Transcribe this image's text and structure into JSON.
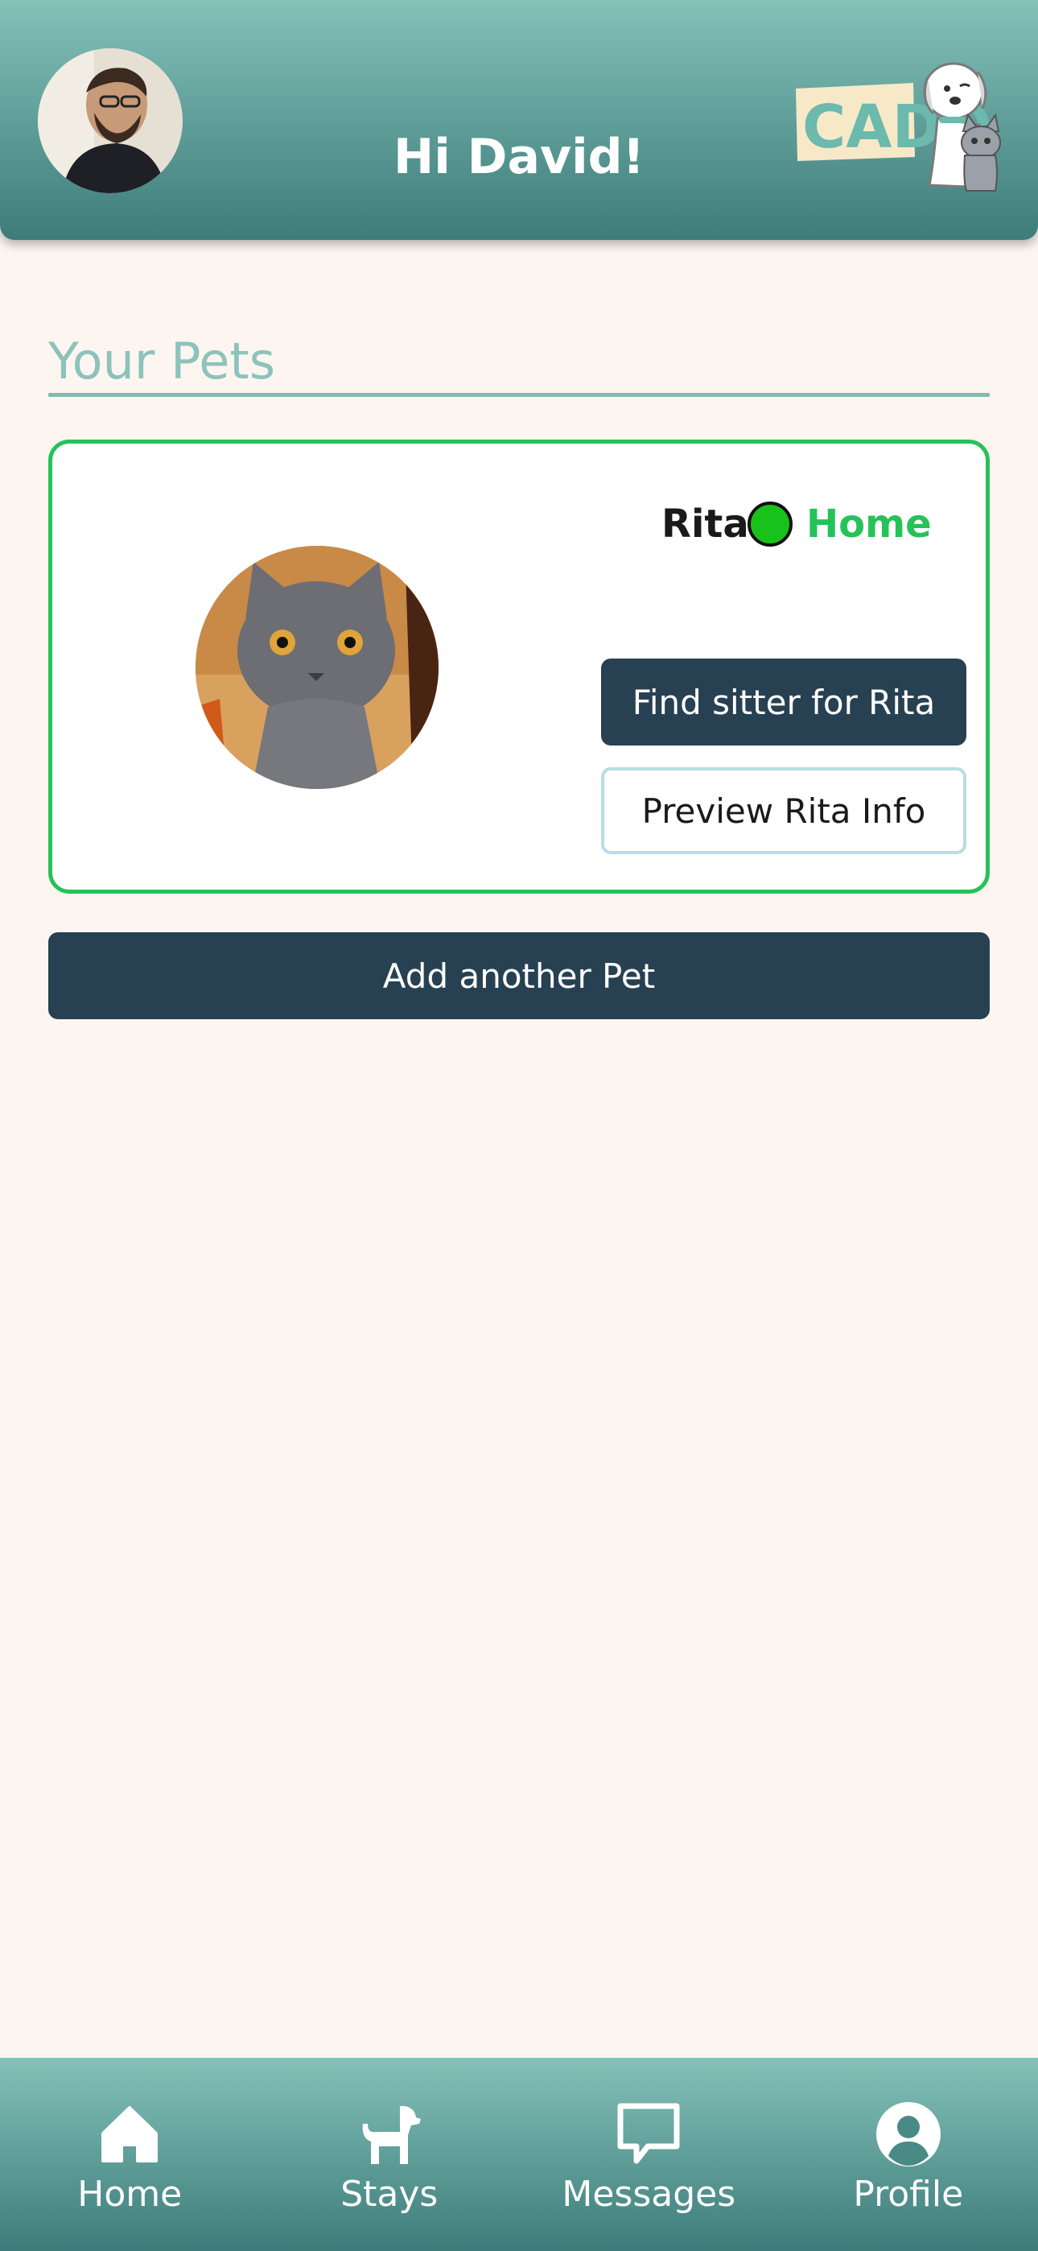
{
  "header": {
    "greeting": "Hi David!",
    "logo_text": "CADO"
  },
  "pets_section": {
    "title": "Your Pets"
  },
  "pets": [
    {
      "name": "Rita",
      "status": "Home",
      "status_color": "#27c15a",
      "find_sitter_label": "Find sitter for Rita",
      "preview_label": "Preview Rita Info"
    }
  ],
  "add_pet_label": "Add another Pet",
  "nav": {
    "items": [
      {
        "label": "Home",
        "icon": "home-icon"
      },
      {
        "label": "Stays",
        "icon": "dog-icon"
      },
      {
        "label": "Messages",
        "icon": "chat-bubble-icon"
      },
      {
        "label": "Profile",
        "icon": "user-circle-icon"
      }
    ]
  },
  "colors": {
    "header_top": "#84c1b9",
    "header_bottom": "#3d7c7a",
    "background": "#fdf5f0",
    "primary_button": "#274152",
    "card_border": "#27c15a",
    "section_title": "#8cc3bb"
  }
}
